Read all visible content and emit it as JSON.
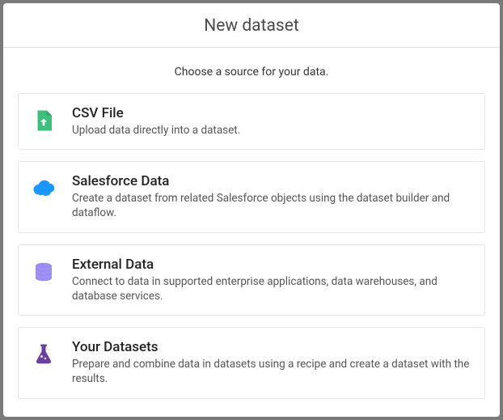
{
  "modal": {
    "title": "New dataset",
    "subtitle": "Choose a source for your data."
  },
  "options": [
    {
      "icon": "file-upload-icon",
      "title": "CSV File",
      "desc": "Upload data directly into a dataset."
    },
    {
      "icon": "cloud-icon",
      "title": "Salesforce Data",
      "desc": "Create a dataset from related Salesforce objects using the dataset builder and dataflow."
    },
    {
      "icon": "database-icon",
      "title": "External Data",
      "desc": "Connect to data in supported enterprise applications, data warehouses, and database services."
    },
    {
      "icon": "flask-icon",
      "title": "Your Datasets",
      "desc": "Prepare and combine data in datasets using a recipe and create a dataset with the results."
    }
  ],
  "colors": {
    "csv": "#3cc07b",
    "cloud": "#1b96ff",
    "db": "#9b8cf2",
    "flask": "#6b3fa0"
  }
}
